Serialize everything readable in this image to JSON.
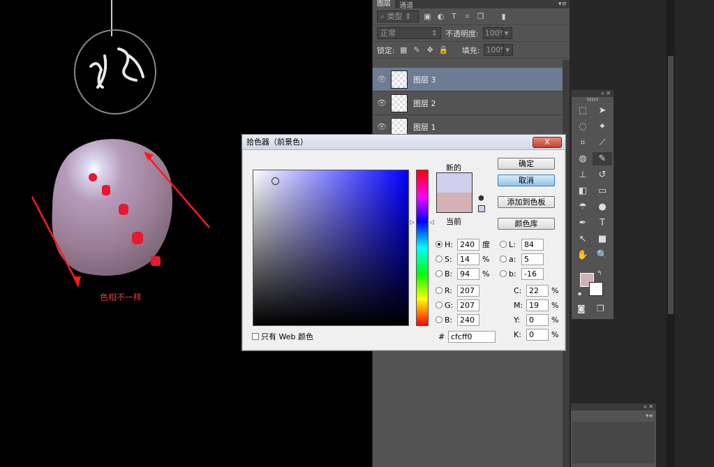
{
  "canvas": {
    "annotation": "色相不一样",
    "colors": {
      "arrow": "#ff1a1a",
      "ball": "#9c7f96",
      "highlight": "#dcdaf0",
      "dot": "#e8192c"
    }
  },
  "layers_panel": {
    "tabs": [
      "图层",
      "通道"
    ],
    "filter_kind": "类型",
    "blend_mode": "正常",
    "opacity_label": "不透明度:",
    "opacity_value": "100%",
    "lock_label": "锁定:",
    "fill_label": "填充:",
    "fill_value": "100%",
    "layers": [
      {
        "name": "图层 3",
        "selected": true
      },
      {
        "name": "图层 2",
        "selected": false
      },
      {
        "name": "图层 1",
        "selected": false
      }
    ]
  },
  "tools_panel": {
    "tools": [
      [
        "marquee-icon",
        "move-icon"
      ],
      [
        "lasso-icon",
        "magic-wand-icon"
      ],
      [
        "crop-icon",
        "eyedropper-icon"
      ],
      [
        "healing-brush-icon",
        "brush-icon"
      ],
      [
        "stamp-icon",
        "history-brush-icon"
      ],
      [
        "eraser-icon",
        "gradient-icon"
      ],
      [
        "blur-icon",
        "dodge-icon"
      ],
      [
        "pen-icon",
        "type-icon"
      ],
      [
        "path-select-icon",
        "rectangle-icon"
      ],
      [
        "hand-icon",
        "zoom-icon"
      ]
    ],
    "foreground_color": "#d4b0b8",
    "background_color": "#ffffff"
  },
  "dialog": {
    "title": "拾色器（前景色）",
    "close_label": "X",
    "new_label": "新的",
    "current_label": "当前",
    "buttons": {
      "ok": "确定",
      "cancel": "取消",
      "add_swatch": "添加到色板",
      "libraries": "颜色库"
    },
    "hsb": [
      {
        "label": "H:",
        "value": "240",
        "unit": "度",
        "checked": true
      },
      {
        "label": "S:",
        "value": "14",
        "unit": "%",
        "checked": false
      },
      {
        "label": "B:",
        "value": "94",
        "unit": "%",
        "checked": false
      }
    ],
    "rgb": [
      {
        "label": "R:",
        "value": "207",
        "checked": false
      },
      {
        "label": "G:",
        "value": "207",
        "checked": false
      },
      {
        "label": "B:",
        "value": "240",
        "checked": false
      }
    ],
    "lab": [
      {
        "label": "L:",
        "value": "84",
        "checked": false
      },
      {
        "label": "a:",
        "value": "5",
        "checked": false
      },
      {
        "label": "b:",
        "value": "-16",
        "checked": false
      }
    ],
    "cmyk": [
      {
        "label": "C:",
        "value": "22",
        "unit": "%"
      },
      {
        "label": "M:",
        "value": "19",
        "unit": "%"
      },
      {
        "label": "Y:",
        "value": "0",
        "unit": "%"
      },
      {
        "label": "K:",
        "value": "0",
        "unit": "%"
      }
    ],
    "hex_label": "#",
    "hex_value": "cfcff0",
    "web_only_label": "只有 Web 颜色",
    "new_color": "#cfcff0",
    "current_color": "#d5b0b5"
  }
}
